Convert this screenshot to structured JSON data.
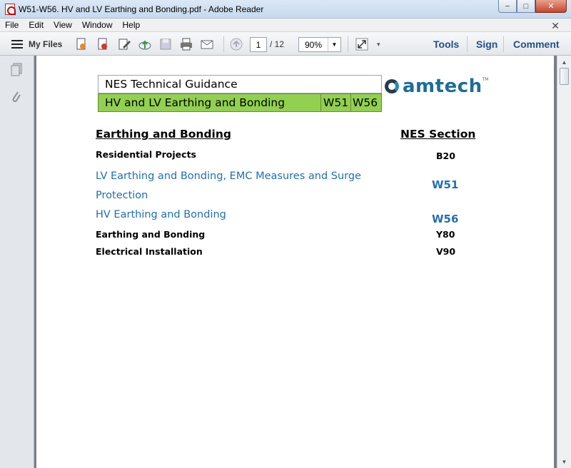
{
  "window": {
    "title": "W51-W56. HV and LV Earthing and Bonding.pdf - Adobe Reader",
    "minimize": "−",
    "maximize": "□",
    "close": "✕"
  },
  "menubar": {
    "items": [
      "File",
      "Edit",
      "View",
      "Window",
      "Help"
    ],
    "close_doc": "✕"
  },
  "toolbar": {
    "my_files": "My Files",
    "page_current": "1",
    "page_total": "/ 12",
    "zoom": "90%",
    "tools": "Tools",
    "sign": "Sign",
    "comment": "Comment"
  },
  "document": {
    "header_title": "NES Technical Guidance",
    "header_subtitle": "HV and LV Earthing and Bonding",
    "header_code1": "W51",
    "header_code2": "W56",
    "logo_text": "amtech",
    "logo_tm": "TM",
    "section_left": "Earthing and Bonding",
    "section_right": "NES Section",
    "rows": [
      {
        "label": "Residential Projects",
        "code": "B20"
      },
      {
        "label": "LV Earthing and Bonding, EMC Measures and Surge Protection",
        "code": "W51"
      },
      {
        "label": "HV Earthing and Bonding",
        "code": "W56"
      },
      {
        "label": "Earthing and Bonding",
        "code": "Y80"
      },
      {
        "label": "Electrical Installation",
        "code": "V90"
      }
    ]
  },
  "colors": {
    "green_header": "#92d050",
    "link_blue": "#1f6fb7",
    "logo_blue": "#1b6e98"
  }
}
